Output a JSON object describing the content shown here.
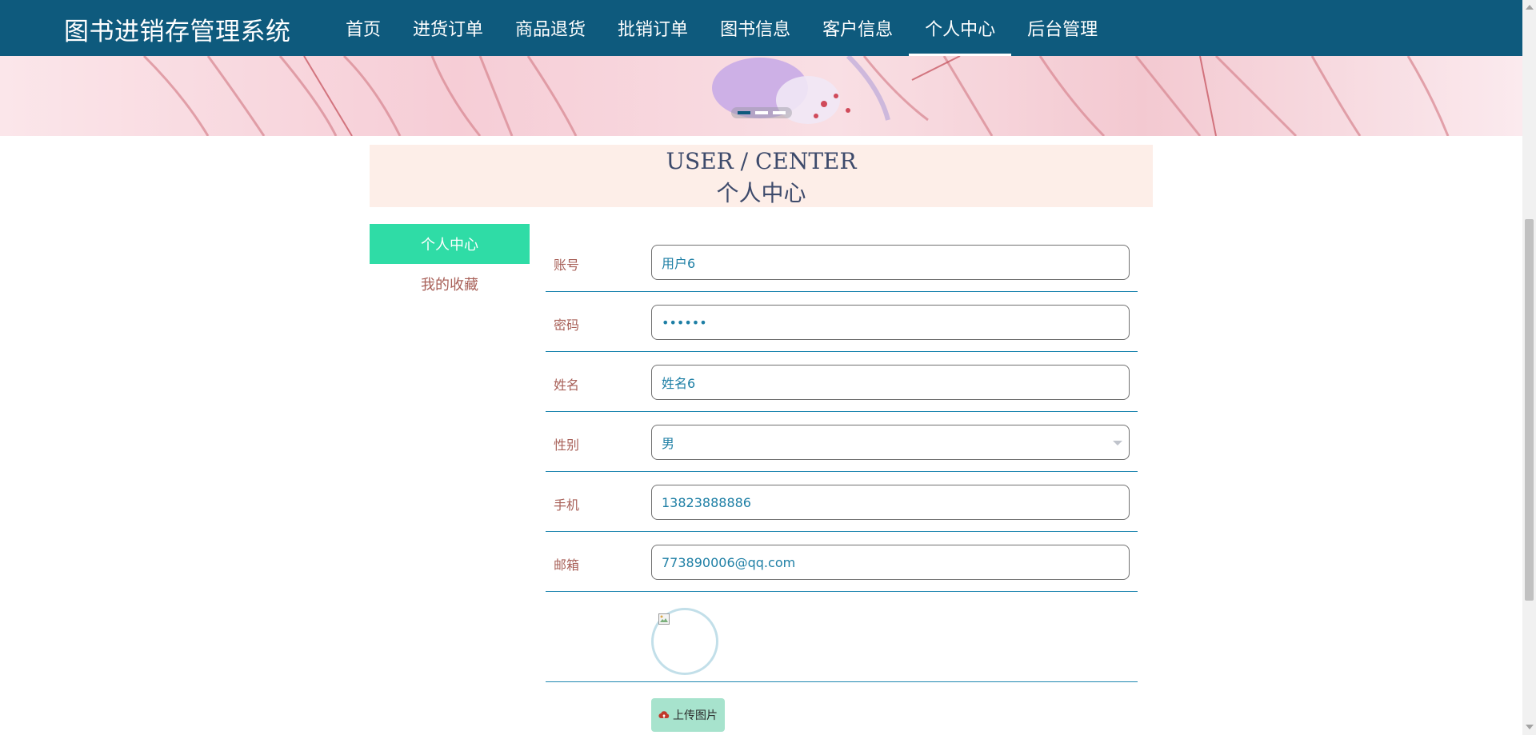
{
  "header": {
    "brand": "图书进销存管理系统",
    "nav": [
      {
        "label": "首页",
        "active": false
      },
      {
        "label": "进货订单",
        "active": false
      },
      {
        "label": "商品退货",
        "active": false
      },
      {
        "label": "批销订单",
        "active": false
      },
      {
        "label": "图书信息",
        "active": false
      },
      {
        "label": "客户信息",
        "active": false
      },
      {
        "label": "个人中心",
        "active": true
      },
      {
        "label": "后台管理",
        "active": false
      }
    ]
  },
  "banner": {
    "slide_count": 3,
    "active_slide": 1
  },
  "section": {
    "title_en": "USER / CENTER",
    "title_cn": "个人中心"
  },
  "sidebar": {
    "items": [
      {
        "label": "个人中心",
        "active": true
      },
      {
        "label": "我的收藏",
        "active": false
      }
    ]
  },
  "form": {
    "account": {
      "label": "账号",
      "value": "用户6"
    },
    "password": {
      "label": "密码",
      "value": "••••••"
    },
    "name": {
      "label": "姓名",
      "value": "姓名6"
    },
    "gender": {
      "label": "性别",
      "value": "男"
    },
    "phone": {
      "label": "手机",
      "value": "13823888886"
    },
    "email": {
      "label": "邮箱",
      "value": "773890006@qq.com"
    },
    "upload_label": "上传图片"
  },
  "colors": {
    "topbar": "#0e5a7d",
    "sidebar_active": "#2fdca6",
    "label_text": "#a86058",
    "field_text": "#1e7fa5",
    "section_bg": "#fdeee8",
    "upload_button": "#a7e3cd"
  },
  "icons": {
    "upload": "cloud-upload-icon",
    "select": "chevron-down-icon",
    "avatar": "broken-image-icon"
  }
}
